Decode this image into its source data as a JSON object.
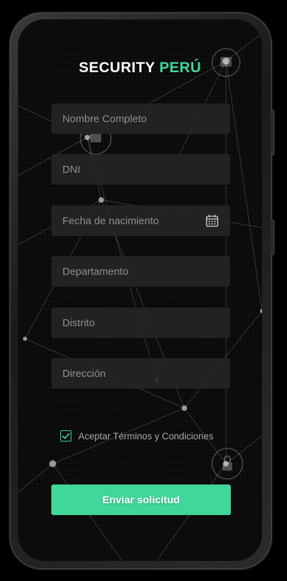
{
  "brand": {
    "part1": "SECURITY",
    "part2": "PERÚ"
  },
  "form": {
    "name_placeholder": "Nombre Completo",
    "dni_placeholder": "DNI",
    "birthdate_placeholder": "Fecha de nacimiento",
    "department_placeholder": "Departamento",
    "district_placeholder": "Distrito",
    "address_placeholder": "Dirección"
  },
  "terms": {
    "label": "Aceptar Términos y Condiciones",
    "checked": true
  },
  "submit_label": "Enviar solicitud",
  "colors": {
    "accent": "#3fd79a",
    "background": "#0b0b0c",
    "field": "#262628"
  },
  "icons": [
    "calendar-icon",
    "checkmark-icon"
  ]
}
